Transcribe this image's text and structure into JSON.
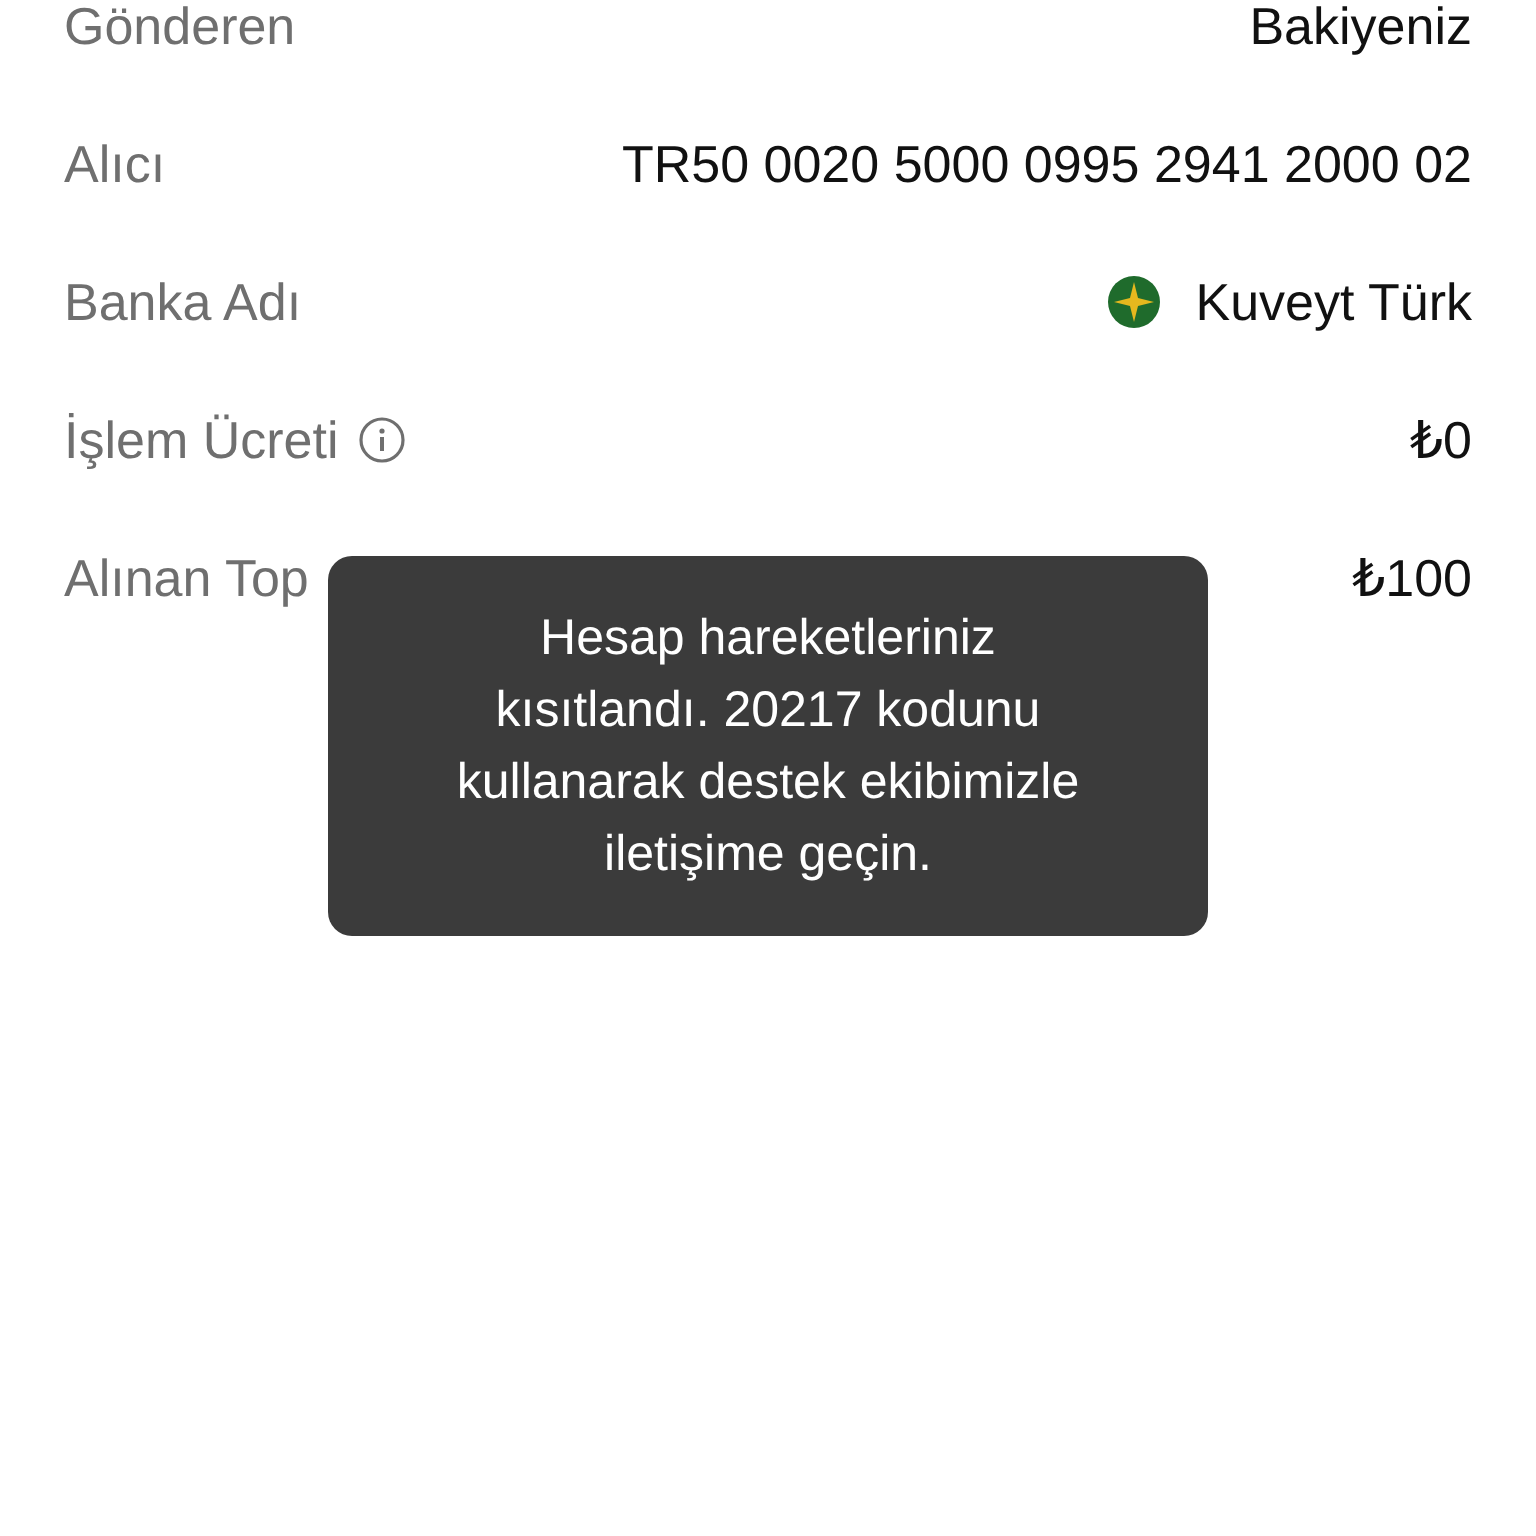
{
  "rows": [
    {
      "label": "Gönderen",
      "value": "Bakiyeniz",
      "kind": "text"
    },
    {
      "label": "Alıcı",
      "value": "TR50 0020 5000 0995 2941 2000 02",
      "kind": "text"
    },
    {
      "label": "Banka Adı",
      "value": "Kuveyt Türk",
      "kind": "bank"
    },
    {
      "label": "İşlem Ücreti",
      "value": "₺0",
      "kind": "text",
      "info": true
    },
    {
      "label": "Alınan Top",
      "value": "₺100",
      "kind": "text"
    }
  ],
  "toast": {
    "message": "Hesap hareketleriniz\nkısıtlandı. 20217 kodunu\nkullanarak destek ekibimizle\niletişime geçin."
  }
}
